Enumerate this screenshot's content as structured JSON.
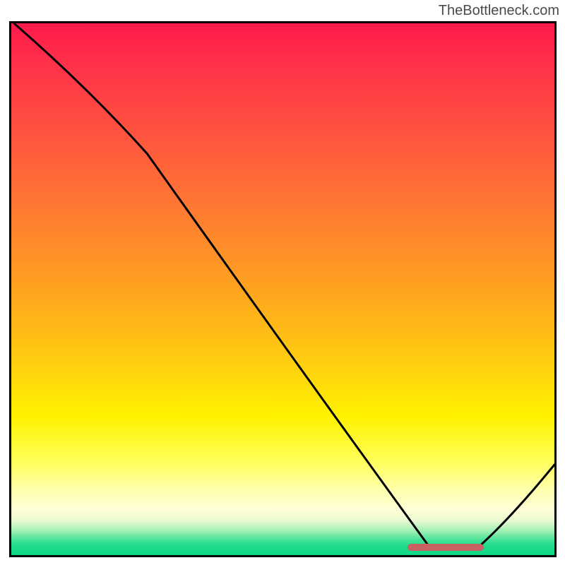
{
  "attribution": "TheBottleneck.com",
  "chart_data": {
    "type": "line",
    "title": "",
    "xlabel": "",
    "ylabel": "",
    "xlim": [
      0,
      100
    ],
    "ylim": [
      0,
      100
    ],
    "grid": "off",
    "background": "gradient-bottleneck",
    "curve_xy": [
      [
        0.5,
        100
      ],
      [
        25,
        75.5
      ],
      [
        77,
        1.5
      ],
      [
        86,
        1.5
      ],
      [
        100,
        17
      ]
    ],
    "optimal_band": {
      "x_start": 73,
      "x_end": 87,
      "y": 1.5
    },
    "colors": {
      "top": "#ff1a4b",
      "mid": "#fff200",
      "bottom": "#0ed986",
      "curve": "#000000",
      "marker": "#c86262",
      "border": "#000000"
    }
  },
  "plot": {
    "inner_w": 769,
    "inner_h": 753
  }
}
